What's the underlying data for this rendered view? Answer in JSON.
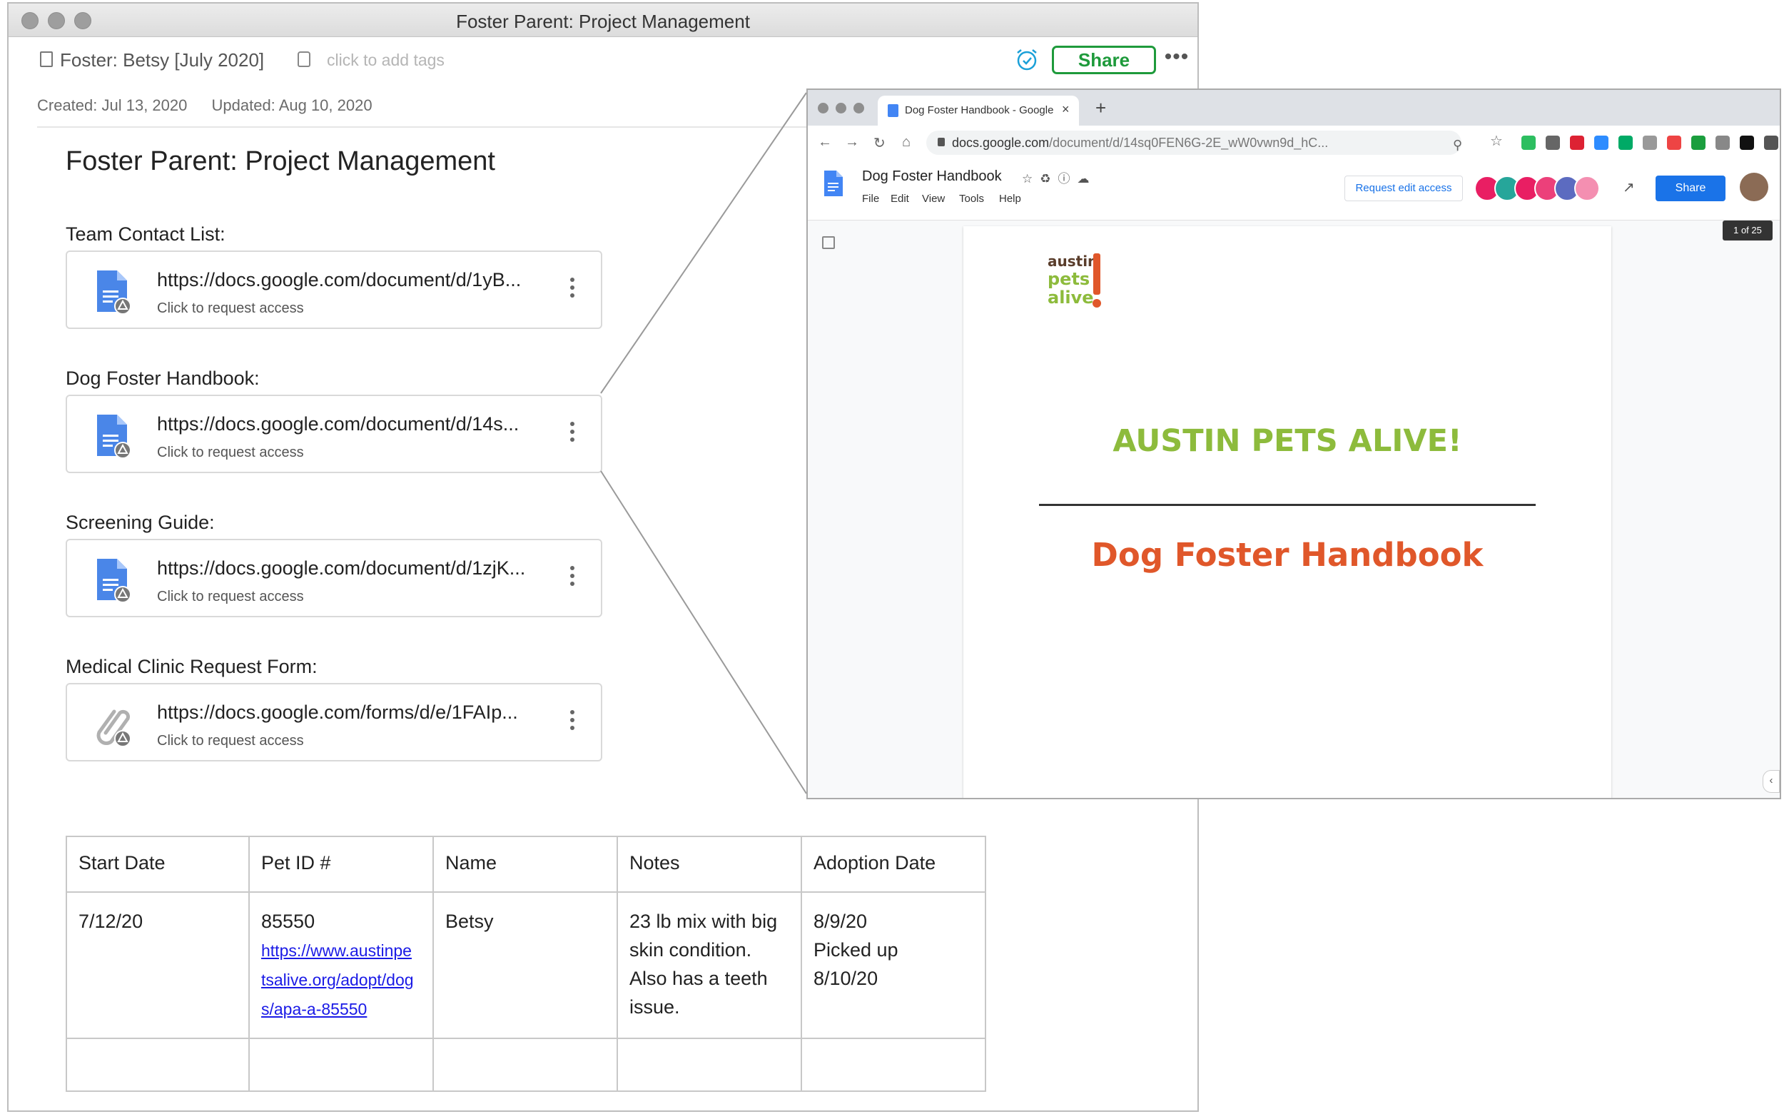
{
  "note_window": {
    "title": "Foster Parent: Project Management",
    "notebook": "Foster: Betsy [July 2020]",
    "tags_placeholder": "click to add tags",
    "share_label": "Share",
    "more_label": "•••",
    "created": "Created: Jul 13, 2020",
    "updated": "Updated: Aug 10, 2020",
    "heading": "Foster Parent: Project Management",
    "sections": [
      {
        "label": "Team Contact List:",
        "url": "https://docs.google.com/document/d/1yB...",
        "sub": "Click to request access",
        "icon": "google-docs-icon"
      },
      {
        "label": "Dog Foster Handbook:",
        "url": "https://docs.google.com/document/d/14s...",
        "sub": "Click to request access",
        "icon": "google-docs-icon"
      },
      {
        "label": "Screening Guide:",
        "url": "https://docs.google.com/document/d/1zjK...",
        "sub": "Click to request access",
        "icon": "google-docs-icon"
      },
      {
        "label": "Medical Clinic Request Form:",
        "url": "https://docs.google.com/forms/d/e/1FAIp...",
        "sub": "Click to request access",
        "icon": "paperclip-icon"
      }
    ],
    "table": {
      "headers": [
        "Start Date",
        "Pet ID #",
        "Name",
        "Notes",
        "Adoption Date"
      ],
      "row": {
        "start_date": "7/12/20",
        "pet_id": "85550",
        "pet_link_lines": [
          "https://www.austinpe",
          "tsalive.org/adopt/dog",
          "s/apa-a-85550"
        ],
        "name": "Betsy",
        "notes_lines": [
          "23 lb mix with big",
          "skin condition.",
          "Also has a teeth",
          "issue."
        ],
        "adoption_lines": [
          "8/9/20",
          "Picked up",
          "8/10/20"
        ]
      }
    }
  },
  "chrome": {
    "tab_title": "Dog Foster Handbook - Google",
    "tab_close": "×",
    "new_tab": "+",
    "url_host": "docs.google.com",
    "url_path": "/document/d/14sq0FEN6G-2E_wW0vwn9d_hC...",
    "docs": {
      "title": "Dog Foster Handbook",
      "menu": [
        "File",
        "Edit",
        "View",
        "Tools",
        "Help"
      ],
      "request_edit": "Request edit access",
      "share": "Share",
      "page_counter": "1 of 25",
      "logo_text": [
        "austin",
        "pets",
        "alive"
      ],
      "heading": "AUSTIN PETS ALIVE!",
      "subheading": "Dog Foster Handbook"
    }
  },
  "colors": {
    "share_green": "#1e9a3b",
    "apa_green": "#8dbb3c",
    "handbook_orange": "#e0572a",
    "docs_blue": "#1a73e8",
    "link_blue": "#1a1ae6"
  }
}
